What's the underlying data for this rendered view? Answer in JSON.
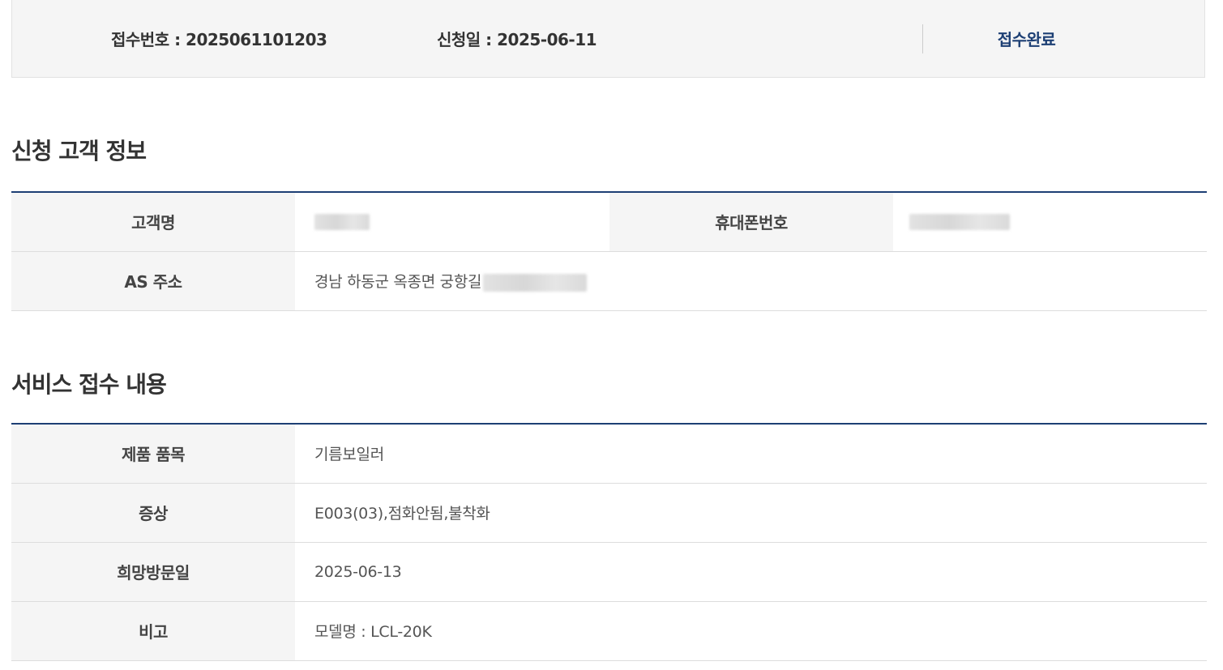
{
  "summary": {
    "receipt_number": "접수번호 : 2025061101203",
    "apply_date": "신청일 : 2025-06-11",
    "status": "접수완료"
  },
  "customer_section": {
    "title": "신청 고객 정보",
    "name_label": "고객명",
    "phone_label": "휴대폰번호",
    "address_label": "AS 주소",
    "address_value": "경남 하동군 옥종면 궁항길"
  },
  "service_section": {
    "title": "서비스 접수 내용",
    "product_label": "제품 품목",
    "product_value": "기름보일러",
    "symptom_label": "증상",
    "symptom_value": "E003(03),점화안됨,불착화",
    "visit_date_label": "희망방문일",
    "visit_date_value": "2025-06-13",
    "note_label": "비고",
    "note_value": "모델명 : LCL-20K"
  },
  "colors": {
    "accent": "#1d3f74",
    "header_bg": "#f5f5f5",
    "border": "#dddddd"
  }
}
